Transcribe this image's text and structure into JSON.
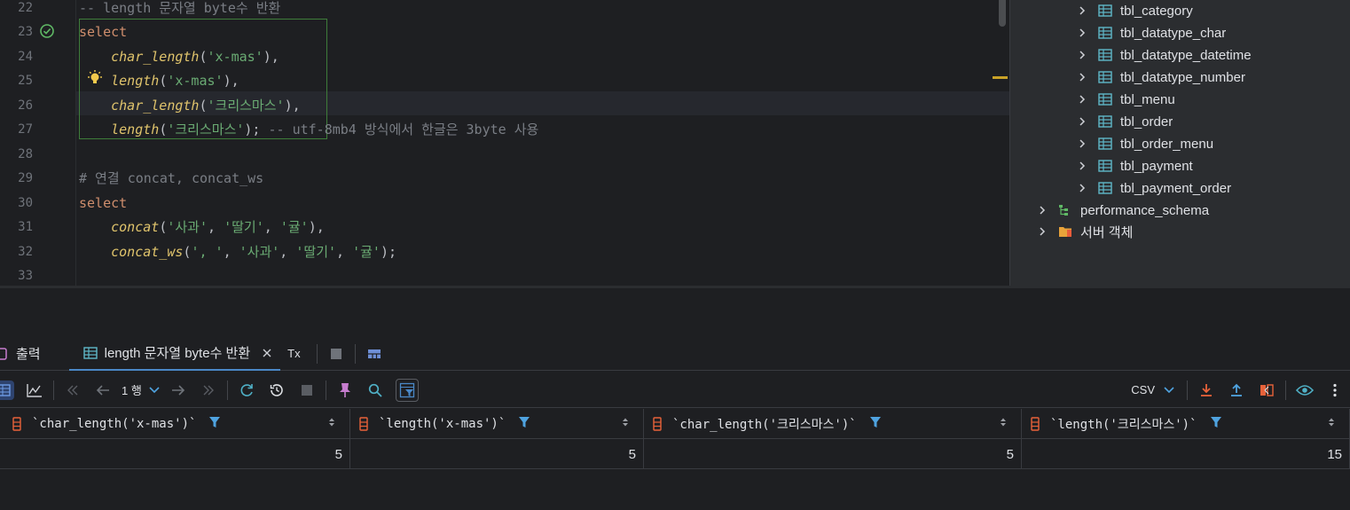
{
  "editor": {
    "lines": [
      {
        "no": "22",
        "segments": [
          {
            "t": "-- length 문자열 byte수 반환",
            "c": "cm"
          }
        ]
      },
      {
        "no": "23",
        "segments": [
          {
            "t": "select",
            "c": "kw"
          }
        ]
      },
      {
        "no": "24",
        "segments": [
          {
            "t": "    ",
            "c": "p"
          },
          {
            "t": "char_length",
            "c": "fn"
          },
          {
            "t": "(",
            "c": "p"
          },
          {
            "t": "'x-mas'",
            "c": "str"
          },
          {
            "t": "),",
            "c": "p"
          }
        ]
      },
      {
        "no": "25",
        "segments": [
          {
            "t": "    ",
            "c": "p"
          },
          {
            "t": "length",
            "c": "fn"
          },
          {
            "t": "(",
            "c": "p"
          },
          {
            "t": "'x-mas'",
            "c": "str"
          },
          {
            "t": "),",
            "c": "p"
          }
        ]
      },
      {
        "no": "26",
        "segments": [
          {
            "t": "    ",
            "c": "p"
          },
          {
            "t": "char_length",
            "c": "fn"
          },
          {
            "t": "(",
            "c": "p"
          },
          {
            "t": "'크리스마스'",
            "c": "str"
          },
          {
            "t": "),",
            "c": "p"
          }
        ]
      },
      {
        "no": "27",
        "segments": [
          {
            "t": "    ",
            "c": "p"
          },
          {
            "t": "length",
            "c": "fn"
          },
          {
            "t": "(",
            "c": "p"
          },
          {
            "t": "'크리스마스'",
            "c": "str"
          },
          {
            "t": ");",
            "c": "p"
          },
          {
            "t": " -- utf-8mb4 방식에서 한글은 3byte 사용",
            "c": "cm"
          }
        ]
      },
      {
        "no": "28",
        "segments": []
      },
      {
        "no": "29",
        "segments": [
          {
            "t": "# 연결 concat, concat_ws",
            "c": "cm"
          }
        ]
      },
      {
        "no": "30",
        "segments": [
          {
            "t": "select",
            "c": "kw"
          }
        ]
      },
      {
        "no": "31",
        "segments": [
          {
            "t": "    ",
            "c": "p"
          },
          {
            "t": "concat",
            "c": "fn"
          },
          {
            "t": "(",
            "c": "p"
          },
          {
            "t": "'사과'",
            "c": "str"
          },
          {
            "t": ", ",
            "c": "p"
          },
          {
            "t": "'딸기'",
            "c": "str"
          },
          {
            "t": ", ",
            "c": "p"
          },
          {
            "t": "'귤'",
            "c": "str"
          },
          {
            "t": "),",
            "c": "p"
          }
        ]
      },
      {
        "no": "32",
        "segments": [
          {
            "t": "    ",
            "c": "p"
          },
          {
            "t": "concat_ws",
            "c": "fn"
          },
          {
            "t": "(",
            "c": "p"
          },
          {
            "t": "', '",
            "c": "str"
          },
          {
            "t": ", ",
            "c": "p"
          },
          {
            "t": "'사과'",
            "c": "str"
          },
          {
            "t": ", ",
            "c": "p"
          },
          {
            "t": "'딸기'",
            "c": "str"
          },
          {
            "t": ", ",
            "c": "p"
          },
          {
            "t": "'귤'",
            "c": "str"
          },
          {
            "t": ");",
            "c": "p"
          }
        ]
      },
      {
        "no": "33",
        "segments": []
      }
    ]
  },
  "tree": {
    "tables": [
      "tbl_category",
      "tbl_datatype_char",
      "tbl_datatype_datetime",
      "tbl_datatype_number",
      "tbl_menu",
      "tbl_order",
      "tbl_order_menu",
      "tbl_payment",
      "tbl_payment_order"
    ],
    "schema": "performance_schema",
    "server_objects": "서버 객체"
  },
  "tabs": {
    "output": "출력",
    "result": "length 문자열 byte수 반환",
    "tx": "Tx"
  },
  "toolbar": {
    "rows": "1 행",
    "format": "CSV"
  },
  "grid": {
    "columns": [
      "`char_length('x-mas')`",
      "`length('x-mas')`",
      "`char_length('크리스마스')`",
      "`length('크리스마스')`"
    ],
    "rows": [
      [
        "5",
        "5",
        "5",
        "15"
      ]
    ]
  },
  "colors": {
    "keyword": "#cf8e6d",
    "function": "#e0c46c",
    "string": "#6aab73",
    "comment": "#7a7e85",
    "accent": "#4a88c7"
  }
}
